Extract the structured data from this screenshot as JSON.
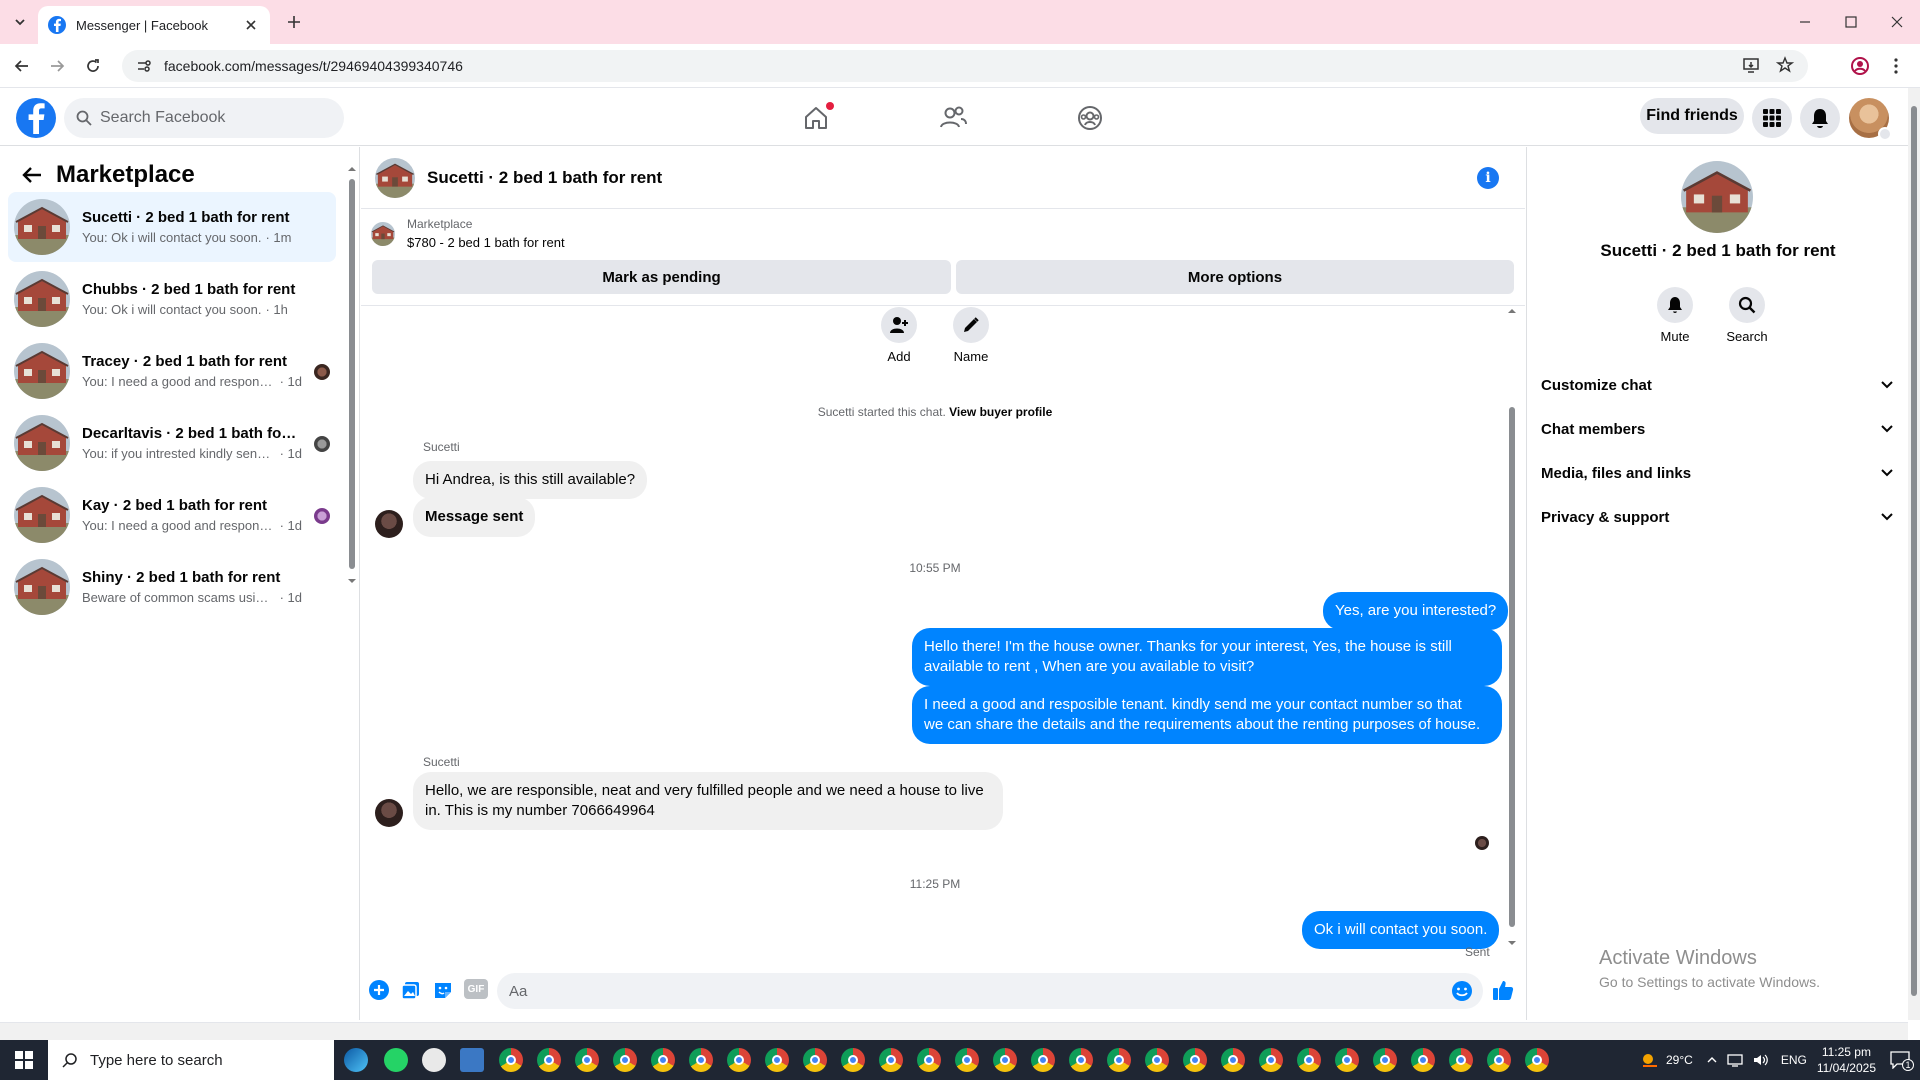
{
  "browser": {
    "tab_title": "Messenger | Facebook",
    "url": "facebook.com/messages/t/29469404399340746"
  },
  "fb_nav": {
    "search_placeholder": "Search Facebook",
    "find_friends": "Find friends"
  },
  "left": {
    "title": "Marketplace",
    "conversations": [
      {
        "title": "Sucetti · 2 bed 1 bath for rent",
        "preview": "You: Ok i will contact you soon.",
        "time": "· 1m",
        "active": true
      },
      {
        "title": "Chubbs · 2 bed 1 bath for rent",
        "preview": "You: Ok i will contact you soon.",
        "time": "· 1h"
      },
      {
        "title": "Tracey · 2 bed 1 bath for rent",
        "preview": "You: I need a good and responsibl...",
        "time": "· 1d"
      },
      {
        "title": "Decarltavis · 2 bed 1 bath for r...",
        "preview": "You: if you intrested kindly send ...",
        "time": "· 1d"
      },
      {
        "title": "Kay · 2 bed 1 bath for rent",
        "preview": "You: I need a good and responsibl...",
        "time": "· 1d"
      },
      {
        "title": "Shiny · 2 bed 1 bath for rent",
        "preview": "Beware of common scams using pa...",
        "time": "· 1d"
      }
    ]
  },
  "chat": {
    "title": "Sucetti · 2 bed 1 bath for rent",
    "listing_label": "Marketplace",
    "listing_price": "$780 - 2 bed 1 bath for rent",
    "mark_pending": "Mark as pending",
    "more_options": "More options",
    "add_label": "Add",
    "name_label": "Name",
    "started_text": "Sucetti started this chat.",
    "view_profile": "View buyer profile",
    "sender_name": "Sucetti",
    "msg1": "Hi Andrea, is this still available?",
    "msg2": "Message sent",
    "time1": "10:55 PM",
    "out1": "Yes, are you interested?",
    "out2_line1": "Hello there! I'm the house owner. Thanks for your interest, Yes, the house is still",
    "out2_line2": "available to rent , When are you available to visit?",
    "out3_line1": "I need a good and resposible tenant.  kindly send me your contact number so that",
    "out3_line2": "we can share the details and the requirements about the renting purposes of house.",
    "sender_name2": "Sucetti",
    "in3_line1": "Hello, we are responsible, neat and very fulfilled people and we need a house to live",
    "in3_line2": "in. This is my number 7066649964",
    "time2": "11:25 PM",
    "out4": "Ok i will contact you soon.",
    "sent_status": "Sent",
    "composer_placeholder": "Aa",
    "gif_label": "GIF"
  },
  "right": {
    "title": "Sucetti · 2 bed 1 bath for rent",
    "mute": "Mute",
    "search": "Search",
    "sections": [
      "Customize chat",
      "Chat members",
      "Media, files and links",
      "Privacy & support"
    ],
    "activate_line1": "Activate Windows",
    "activate_line2": "Go to Settings to activate Windows."
  },
  "taskbar": {
    "search_placeholder": "Type here to search",
    "weather": "29°C",
    "lang": "ENG",
    "time": "11:25 pm",
    "date": "11/04/2025",
    "notif_count": "1"
  },
  "colors": {
    "fb_blue": "#1877f2",
    "bubble_out": "#0084ff",
    "bubble_in": "#f0f0f0",
    "tab_strip": "#fcdde6"
  }
}
